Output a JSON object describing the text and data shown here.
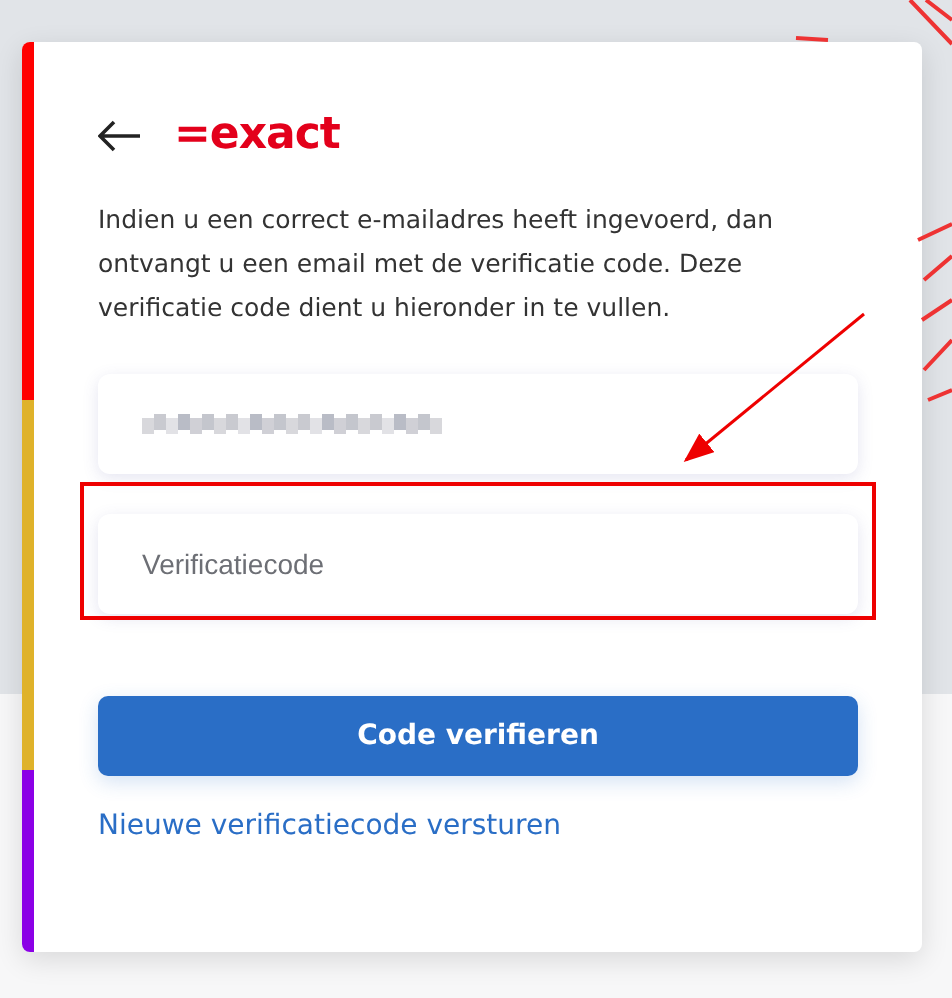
{
  "logo": {
    "text": "=exact"
  },
  "intro": "Indien u een correct e-mailadres heeft ingevoerd, dan ontvangt u een email met de verificatie code. Deze verificatie code dient u hieronder in te vullen.",
  "code_field": {
    "placeholder": "Verificatiecode",
    "highlighted": true
  },
  "submit_button": "Code verifieren",
  "resend_link": "Nieuwe verificatiecode versturen",
  "stripe": [
    {
      "color": "#ff0000"
    },
    {
      "color": "#dfb22a"
    },
    {
      "color": "#8b00e6"
    }
  ]
}
